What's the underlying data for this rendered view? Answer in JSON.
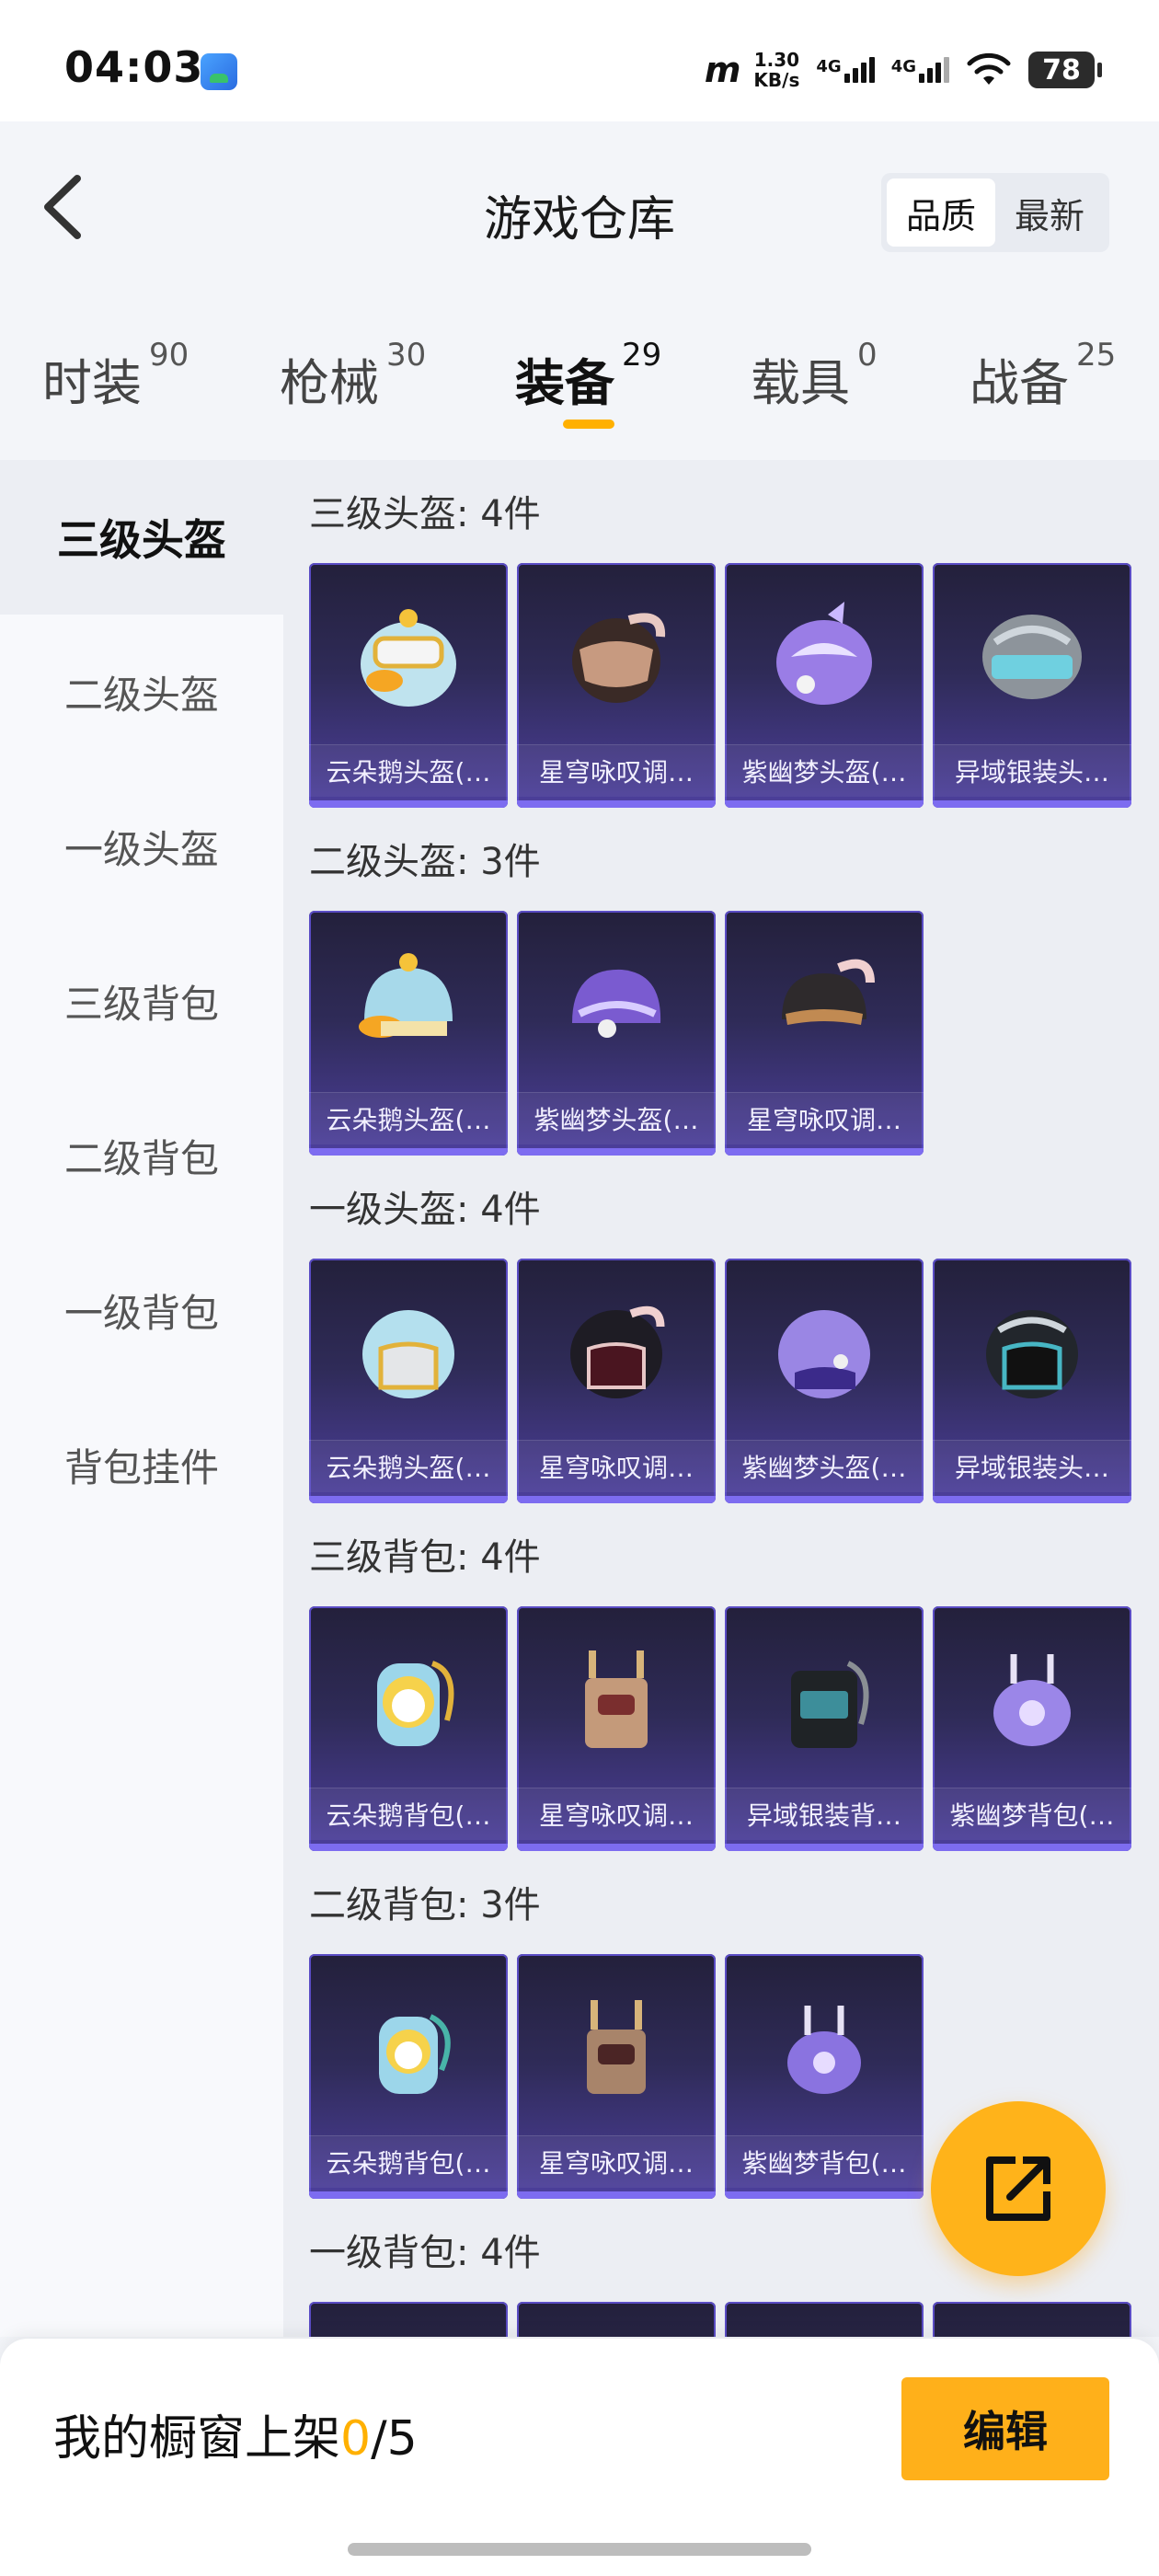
{
  "status_bar": {
    "time": "04:03",
    "speed_value": "1.30",
    "speed_unit": "KB/s",
    "network_1": "4G",
    "network_2": "4G",
    "battery": "78"
  },
  "header": {
    "title": "游戏仓库",
    "sort_options": [
      "品质",
      "最新"
    ],
    "active_sort": "品质"
  },
  "tabs": [
    {
      "label": "时装",
      "count": "90"
    },
    {
      "label": "枪械",
      "count": "30"
    },
    {
      "label": "装备",
      "count": "29"
    },
    {
      "label": "载具",
      "count": "0"
    },
    {
      "label": "战备",
      "count": "25"
    }
  ],
  "active_tab": "装备",
  "sidebar": {
    "items": [
      "三级头盔",
      "二级头盔",
      "一级头盔",
      "三级背包",
      "二级背包",
      "一级背包",
      "背包挂件"
    ],
    "active": "三级头盔"
  },
  "sections": [
    {
      "title": "三级头盔: 4件",
      "items": [
        "云朵鹅头盔(…",
        "星穹咏叹调…",
        "紫幽梦头盔(…",
        "异域银装头…"
      ]
    },
    {
      "title": "二级头盔: 3件",
      "items": [
        "云朵鹅头盔(…",
        "紫幽梦头盔(…",
        "星穹咏叹调…"
      ]
    },
    {
      "title": "一级头盔: 4件",
      "items": [
        "云朵鹅头盔(…",
        "星穹咏叹调…",
        "紫幽梦头盔(…",
        "异域银装头…"
      ]
    },
    {
      "title": "三级背包: 4件",
      "items": [
        "云朵鹅背包(…",
        "星穹咏叹调…",
        "异域银装背…",
        "紫幽梦背包(…"
      ]
    },
    {
      "title": "二级背包: 3件",
      "items": [
        "云朵鹅背包(…",
        "星穹咏叹调…",
        "紫幽梦背包(…"
      ]
    },
    {
      "title": "一级背包: 4件",
      "items": []
    }
  ],
  "bottom_bar": {
    "shelf_label": "我的橱窗上架",
    "shelf_current": "0",
    "shelf_total": "/5",
    "edit_label": "编辑"
  },
  "colors": {
    "accent": "#ffb000",
    "card_bg_top": "#23203b",
    "card_bg_bottom": "#4d3f9d",
    "card_border": "#5a4cc4"
  }
}
